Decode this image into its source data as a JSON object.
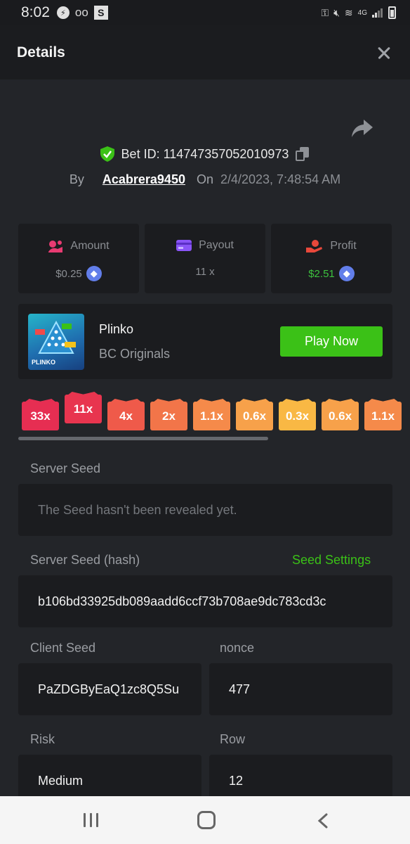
{
  "status_bar": {
    "time": "8:02",
    "network": "4G"
  },
  "header": {
    "title": "Details"
  },
  "bet": {
    "id_label": "Bet ID: 114747357052010973",
    "by_label": "By",
    "username": "Acabrera9450",
    "on_label": "On",
    "date": "2/4/2023, 7:48:54 AM"
  },
  "stats": {
    "amount": {
      "label": "Amount",
      "value": "$0.25"
    },
    "payout": {
      "label": "Payout",
      "value": "11 x"
    },
    "profit": {
      "label": "Profit",
      "value": "$2.51"
    }
  },
  "game": {
    "name": "Plinko",
    "provider": "BC Originals",
    "play_label": "Play Now",
    "thumb_brand": "PLINKO"
  },
  "multipliers": [
    "33x",
    "11x",
    "4x",
    "2x",
    "1.1x",
    "0.6x",
    "0.3x",
    "0.6x",
    "1.1x"
  ],
  "active_multiplier": "11x",
  "seeds": {
    "server_seed_label": "Server Seed",
    "server_seed_placeholder": "The Seed hasn't been revealed yet.",
    "server_seed_hash_label": "Server Seed (hash)",
    "seed_settings_label": "Seed Settings",
    "server_seed_hash": "b106bd33925db089aadd6ccf73b708ae9dc783cd3c",
    "client_seed_label": "Client Seed",
    "client_seed": "PaZDGByEaQ1zc8Q5Su",
    "nonce_label": "nonce",
    "nonce": "477",
    "risk_label": "Risk",
    "risk": "Medium",
    "row_label": "Row",
    "row": "12"
  },
  "colors": {
    "accent_green": "#3bc117",
    "background": "#232529",
    "card": "#1b1c1f"
  }
}
